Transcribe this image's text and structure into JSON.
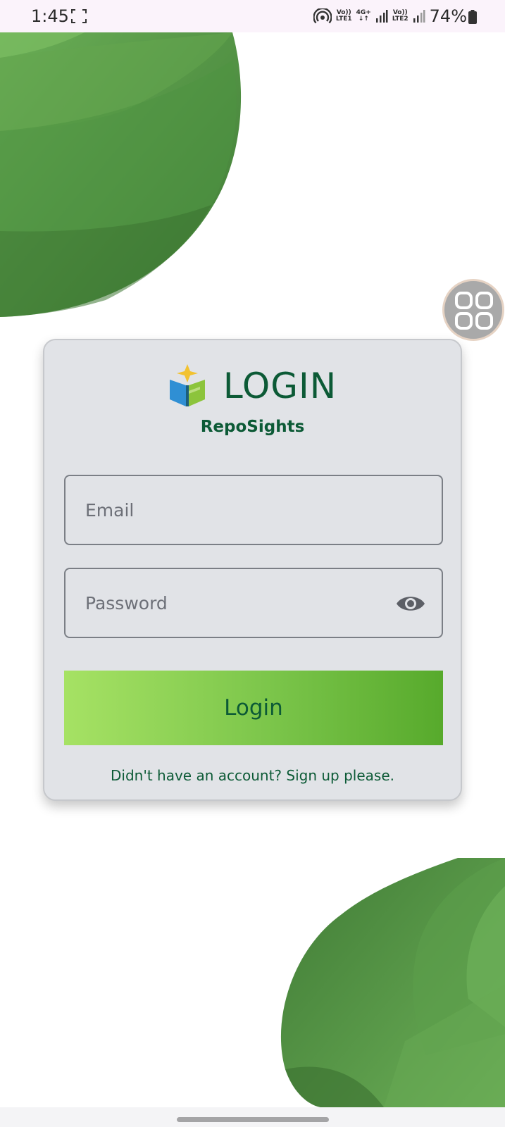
{
  "status_bar": {
    "time": "1:45",
    "network_1": [
      "Vo))",
      "LTE1"
    ],
    "network_type": [
      "4G+",
      "↓↑"
    ],
    "network_2": [
      "Vo))",
      "LTE2"
    ],
    "battery": "74%"
  },
  "login": {
    "title": "LOGIN",
    "brand": "RepoSights",
    "email_placeholder": "Email",
    "password_placeholder": "Password",
    "login_button": "Login",
    "signup_text": "Didn't have an account? Sign up please."
  },
  "colors": {
    "brand_green": "#0c5a36",
    "button_gradient_start": "#a6e264",
    "button_gradient_end": "#57aa2c",
    "card_background": "#e1e3e7",
    "leaf_green": "#4f8f3f"
  },
  "icons": {
    "screenshot": "screenshot-frame-icon",
    "hotspot": "hotspot-icon",
    "signal": "signal-bars-icon",
    "battery": "battery-icon",
    "app_logo": "reposights-logo-icon",
    "password_toggle": "eye-icon",
    "floating": "app-grid-icon"
  }
}
